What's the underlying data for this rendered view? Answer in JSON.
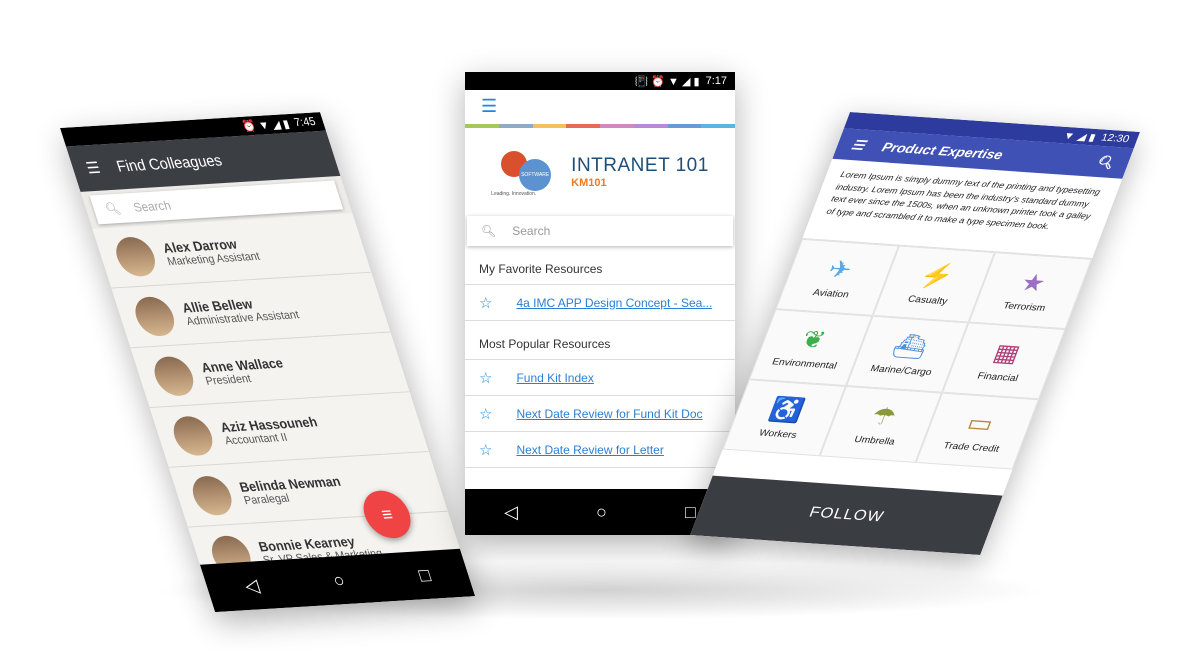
{
  "left": {
    "time": "7:45",
    "title": "Find Colleagues",
    "search_placeholder": "Search",
    "people": [
      {
        "name": "Alex Darrow",
        "role": "Marketing Assistant"
      },
      {
        "name": "Allie Bellew",
        "role": "Administrative Assistant"
      },
      {
        "name": "Anne Wallace",
        "role": "President"
      },
      {
        "name": "Aziz Hassouneh",
        "role": "Accountant II"
      },
      {
        "name": "Belinda Newman",
        "role": "Paralegal"
      },
      {
        "name": "Bonnie Kearney",
        "role": "Sr. VP Sales & Marketing"
      }
    ]
  },
  "center": {
    "time": "7:17",
    "logo": {
      "title": "INTRANET 101",
      "subtitle": "KM101",
      "tagline": "Leading. Innovation.",
      "gear_label": "SOFTWARE"
    },
    "search_placeholder": "Search",
    "favorites_heading": "My Favorite Resources",
    "favorites": [
      "4a IMC APP Design Concept - Sea..."
    ],
    "popular_heading": "Most Popular Resources",
    "popular": [
      "Fund Kit Index",
      "Next Date Review for Fund Kit Doc",
      "Next Date Review for Letter"
    ],
    "stripe_colors": [
      "#a6c85a",
      "#8fa9c9",
      "#f2c15a",
      "#e66a5a",
      "#d08ac0",
      "#b88ad6",
      "#6a9ad6",
      "#5ab6e0"
    ]
  },
  "right": {
    "time": "12:30",
    "title": "Product Expertise",
    "description": "Lorem Ipsum is simply dummy text of the printing and typesetting industry. Lorem Ipsum has been the industry's standard dummy text ever since the 1500s, when an unknown printer took a galley of type and scrambled it to make a type specimen book.",
    "tiles": [
      {
        "label": "Aviation",
        "icon": "✈",
        "color": "#5aa9e6"
      },
      {
        "label": "Casualty",
        "icon": "⚡",
        "color": "#3f51b5"
      },
      {
        "label": "Terrorism",
        "icon": "★",
        "color": "#9b6fc4"
      },
      {
        "label": "Environmental",
        "icon": "❦",
        "color": "#3cae4a"
      },
      {
        "label": "Marine/Cargo",
        "icon": "⛴",
        "color": "#4a90d9"
      },
      {
        "label": "Financial",
        "icon": "▦",
        "color": "#b0407a"
      },
      {
        "label": "Workers",
        "icon": "♿",
        "color": "#5a4fb0"
      },
      {
        "label": "Umbrella",
        "icon": "☂",
        "color": "#8a9a3a"
      },
      {
        "label": "Trade Credit",
        "icon": "▭",
        "color": "#b08a3a"
      }
    ],
    "follow_label": "FOLLOW"
  }
}
